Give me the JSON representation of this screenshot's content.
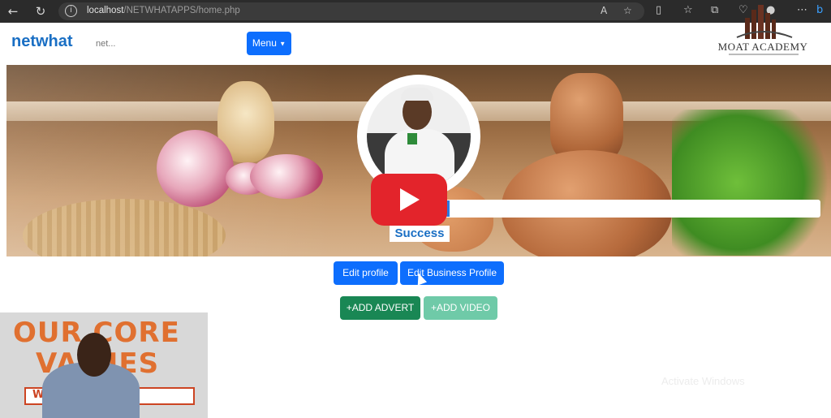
{
  "browser": {
    "url_host": "localhost",
    "url_path": "/NETWHATAPPS/home.php"
  },
  "navbar": {
    "brand": "netwhat",
    "search_placeholder": "net...",
    "menu_label": "Menu"
  },
  "watermark": {
    "logo_text": "MOAT ACADEMY"
  },
  "profile": {
    "subtitle": "Success"
  },
  "actions": {
    "edit_profile": "Edit profile",
    "edit_business_profile": "Edit Business Profile",
    "add_advert": "+ADD ADVERT",
    "add_video": "+ADD VIDEO"
  },
  "webcam": {
    "poster_line1": "OUR CORE",
    "poster_line2": "VALUES",
    "poster_strip": "W        TAL"
  },
  "os_notice": {
    "title": "Activate Windows"
  },
  "colors": {
    "primary": "#0d6efd",
    "success": "#198754",
    "success_light": "#6fcaa8",
    "brand": "#1a6fc4",
    "youtube_red": "#e3242b"
  }
}
